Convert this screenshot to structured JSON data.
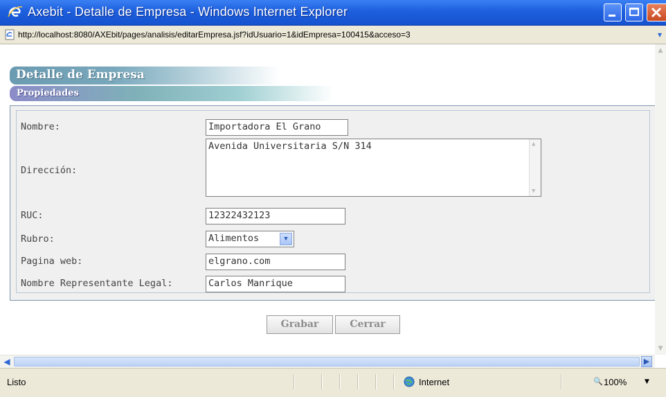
{
  "window": {
    "title": "Axebit - Detalle de Empresa - Windows Internet Explorer"
  },
  "address": {
    "url": "http://localhost:8080/AXEbit/pages/analisis/editarEmpresa.jsf?idUsuario=1&idEmpresa=100415&acceso=3"
  },
  "page": {
    "header": "Detalle de Empresa",
    "section": "Propiedades"
  },
  "form": {
    "nombre": {
      "label": "Nombre:",
      "value": "Importadora El Grano"
    },
    "direccion": {
      "label": "Dirección:",
      "value": "Avenida Universitaria S/N 314"
    },
    "ruc": {
      "label": "RUC:",
      "value": "12322432123"
    },
    "rubro": {
      "label": "Rubro:",
      "value": "Alimentos"
    },
    "web": {
      "label": "Pagina web:",
      "value": "elgrano.com"
    },
    "representante": {
      "label": "Nombre Representante Legal:",
      "value": "Carlos Manrique"
    }
  },
  "buttons": {
    "save": "Grabar",
    "close": "Cerrar"
  },
  "status": {
    "text": "Listo",
    "zone": "Internet",
    "zoom": "100%"
  },
  "colors": {
    "titlebar": "#1d5fdd",
    "chrome": "#ece9d8",
    "banner": "#6b9bb1"
  }
}
